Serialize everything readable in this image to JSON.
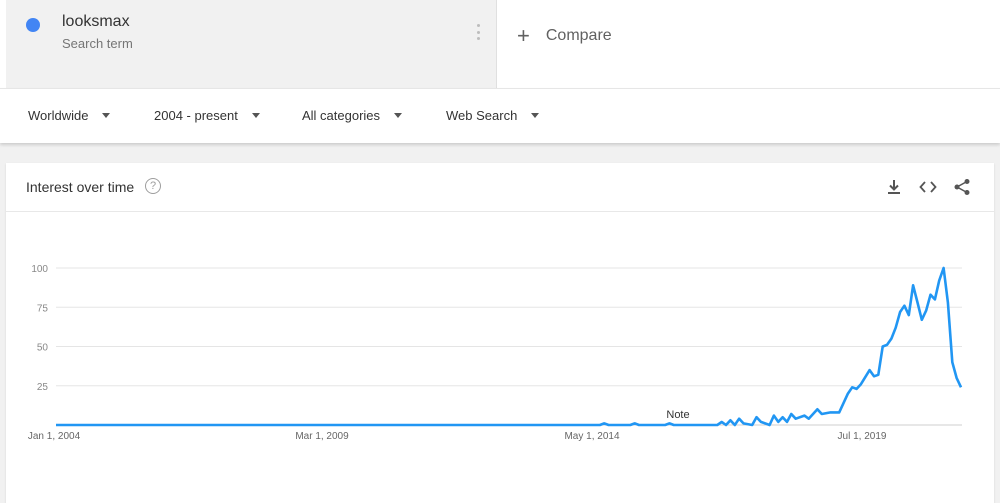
{
  "search_term": {
    "name": "looksmax",
    "subtitle": "Search term",
    "color": "#4285f4"
  },
  "compare": {
    "label": "Compare",
    "icon": "plus-icon"
  },
  "filters": [
    {
      "label": "Worldwide",
      "icon": "caret-down-icon"
    },
    {
      "label": "2004 - present",
      "icon": "caret-down-icon"
    },
    {
      "label": "All categories",
      "icon": "caret-down-icon"
    },
    {
      "label": "Web Search",
      "icon": "caret-down-icon"
    }
  ],
  "card": {
    "title": "Interest over time",
    "help_icon": "?",
    "actions": [
      "download-icon",
      "embed-icon",
      "share-icon"
    ]
  },
  "chart_data": {
    "type": "line",
    "ylim": [
      0,
      100
    ],
    "y_ticks": [
      "100",
      "75",
      "50",
      "25"
    ],
    "x_tick_labels": [
      "Jan 1, 2004",
      "Mar 1, 2009",
      "May 1, 2014",
      "Jul 1, 2019"
    ],
    "annotation": "Note",
    "series": [
      {
        "color": "#2196f3",
        "points": [
          [
            "2004-01",
            0
          ],
          [
            "2014-06",
            0
          ],
          [
            "2014-07",
            1
          ],
          [
            "2014-08",
            0
          ],
          [
            "2015-01",
            0
          ],
          [
            "2015-02",
            1
          ],
          [
            "2015-03",
            0
          ],
          [
            "2015-09",
            0
          ],
          [
            "2015-10",
            1
          ],
          [
            "2015-11",
            0
          ],
          [
            "2016-09",
            0
          ],
          [
            "2016-10",
            2
          ],
          [
            "2016-11",
            0
          ],
          [
            "2016-12",
            3
          ],
          [
            "2017-01",
            0
          ],
          [
            "2017-02",
            4
          ],
          [
            "2017-03",
            1
          ],
          [
            "2017-05",
            0
          ],
          [
            "2017-06",
            5
          ],
          [
            "2017-07",
            2
          ],
          [
            "2017-09",
            0
          ],
          [
            "2017-10",
            6
          ],
          [
            "2017-11",
            2
          ],
          [
            "2017-12",
            5
          ],
          [
            "2018-01",
            2
          ],
          [
            "2018-02",
            7
          ],
          [
            "2018-03",
            4
          ],
          [
            "2018-05",
            6
          ],
          [
            "2018-06",
            4
          ],
          [
            "2018-08",
            10
          ],
          [
            "2018-09",
            7
          ],
          [
            "2018-11",
            8
          ],
          [
            "2019-01",
            8
          ],
          [
            "2019-03",
            20
          ],
          [
            "2019-04",
            24
          ],
          [
            "2019-05",
            23
          ],
          [
            "2019-06",
            26
          ],
          [
            "2019-08",
            35
          ],
          [
            "2019-09",
            31
          ],
          [
            "2019-10",
            32
          ],
          [
            "2019-11",
            50
          ],
          [
            "2019-12",
            51
          ],
          [
            "2020-01",
            55
          ],
          [
            "2020-02",
            62
          ],
          [
            "2020-03",
            72
          ],
          [
            "2020-04",
            76
          ],
          [
            "2020-05",
            70
          ],
          [
            "2020-06",
            89
          ],
          [
            "2020-07",
            78
          ],
          [
            "2020-08",
            67
          ],
          [
            "2020-09",
            73
          ],
          [
            "2020-10",
            83
          ],
          [
            "2020-11",
            80
          ],
          [
            "2020-12",
            92
          ],
          [
            "2021-01",
            100
          ],
          [
            "2021-02",
            78
          ],
          [
            "2021-03",
            40
          ],
          [
            "2021-04",
            30
          ],
          [
            "2021-05",
            24
          ]
        ]
      }
    ]
  }
}
